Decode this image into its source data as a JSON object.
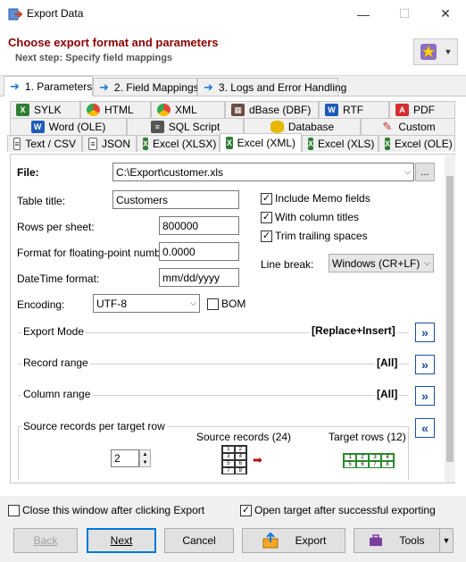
{
  "window": {
    "title": "Export Data",
    "minimize": "—",
    "maximize": "☐",
    "close": "✕"
  },
  "header": {
    "title": "Choose export format and parameters",
    "subtitle": "Next step: Specify field mappings",
    "favorites_icon": "star-icon"
  },
  "wizard_tabs": [
    {
      "label": "1. Parameters",
      "active": true
    },
    {
      "label": "2. Field Mappings",
      "active": false
    },
    {
      "label": "3. Logs and Error Handling",
      "active": false
    }
  ],
  "format_tabs": {
    "row1": [
      "SYLK",
      "HTML",
      "XML",
      "dBase (DBF)",
      "RTF",
      "PDF"
    ],
    "row2": [
      "Word (OLE)",
      "SQL Script",
      "Database",
      "Custom"
    ],
    "row3": [
      "Text / CSV",
      "JSON",
      "Excel (XLSX)",
      "Excel (XML)",
      "Excel (XLS)",
      "Excel (OLE)"
    ],
    "active": "Excel (XML)"
  },
  "form": {
    "file_label": "File:",
    "file_value": "C:\\Export\\customer.xls",
    "browse_label": "...",
    "table_title_label": "Table title:",
    "table_title_value": "Customers",
    "rows_per_sheet_label": "Rows per sheet:",
    "rows_per_sheet_value": "800000",
    "float_format_label": "Format for floating-point numbers:",
    "float_format_value": "0.0000",
    "datetime_label": "DateTime format:",
    "datetime_value": "mm/dd/yyyy",
    "encoding_label": "Encoding:",
    "encoding_value": "UTF-8",
    "bom_label": "BOM",
    "bom_checked": false,
    "include_memo_label": "Include Memo fields",
    "include_memo_checked": true,
    "column_titles_label": "With column titles",
    "column_titles_checked": true,
    "trim_spaces_label": "Trim trailing spaces",
    "trim_spaces_checked": true,
    "line_break_label": "Line break:",
    "line_break_value": "Windows (CR+LF)"
  },
  "sections": {
    "export_mode_label": "Export Mode",
    "export_mode_value": "[Replace+Insert]",
    "record_range_label": "Record range",
    "record_range_value": "[All]",
    "column_range_label": "Column range",
    "column_range_value": "[All]",
    "source_per_target_label": "Source records per target row",
    "source_per_target_value": "2",
    "source_records_label": "Source records (24)",
    "target_rows_label": "Target rows (12)"
  },
  "footer": {
    "close_after_export_label": "Close this window after clicking Export",
    "close_after_export_checked": false,
    "open_target_label": "Open target after successful exporting",
    "open_target_checked": true,
    "back_label": "Back",
    "next_label": "Next",
    "cancel_label": "Cancel",
    "export_label": "Export",
    "tools_label": "Tools"
  },
  "colors": {
    "header_title": "#8b0000",
    "accent_blue": "#1e7bd6",
    "section_button": "#1f4e9c"
  }
}
